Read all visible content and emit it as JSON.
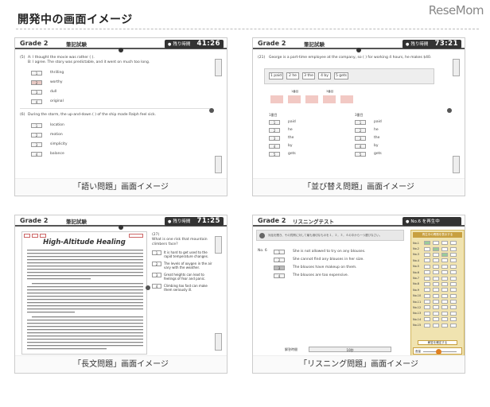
{
  "header": {
    "title": "開発中の画面イメージ",
    "brand": "ReseMom"
  },
  "panels": [
    {
      "caption": "「語い問題」画面イメージ",
      "grade": "Grade 2",
      "subject": "筆記試験",
      "timer_label": "残り時間",
      "time": "41:26",
      "q1": {
        "label": "(5)",
        "line1": "A: I thought the movie was rather (     ).",
        "line2": "B: I agree. The story was predictable, and it went on much too long.",
        "options": [
          {
            "n": "1",
            "t": "thrilling"
          },
          {
            "n": "2",
            "t": "worthy"
          },
          {
            "n": "3",
            "t": "dull"
          },
          {
            "n": "4",
            "t": "original"
          }
        ],
        "selected": "2"
      },
      "q2": {
        "label": "(6)",
        "line1": "During the storm, the up-and-down (     ) of the ship made Ralph feel sick.",
        "options": [
          {
            "n": "1",
            "t": "location"
          },
          {
            "n": "2",
            "t": "motion"
          },
          {
            "n": "3",
            "t": "simplicity"
          },
          {
            "n": "4",
            "t": "balance"
          }
        ]
      }
    },
    {
      "caption": "「並び替え問題」画面イメージ",
      "grade": "Grade 2",
      "subject": "筆記試験",
      "timer_label": "残り時間",
      "time": "73:21",
      "q": {
        "label": "(21)",
        "text": "George is a part-time employee at the company, so (     ) for working 4 hours, he makes $40."
      },
      "tiles": [
        "1 paid",
        "2 he",
        "3 the",
        "4 by",
        "5 gets"
      ],
      "slot_labels": [
        "1番目",
        "3番目"
      ],
      "col1": [
        {
          "n": "1",
          "t": "paid"
        },
        {
          "n": "2",
          "t": "he"
        },
        {
          "n": "3",
          "t": "the"
        },
        {
          "n": "4",
          "t": "by"
        },
        {
          "n": "5",
          "t": "gets"
        }
      ],
      "col2": [
        {
          "n": "1",
          "t": "paid"
        },
        {
          "n": "2",
          "t": "he"
        },
        {
          "n": "3",
          "t": "the"
        },
        {
          "n": "4",
          "t": "by"
        },
        {
          "n": "5",
          "t": "gets"
        }
      ]
    },
    {
      "caption": "「長文問題」画面イメージ",
      "grade": "Grade 2",
      "subject": "筆記試験",
      "timer_label": "残り時間",
      "time": "71:25",
      "article_title": "High-Altitude Healing",
      "q": {
        "label": "(27)",
        "text": "What is one risk that mountain climbers face?",
        "options": [
          {
            "n": "1",
            "t": "It is hard to get used to the rapid temperature changes."
          },
          {
            "n": "2",
            "t": "The levels of oxygen in the air vary with the weather."
          },
          {
            "n": "3",
            "t": "Great heights can lead to feelings of fear and panic."
          },
          {
            "n": "4",
            "t": "Climbing too fast can make them seriously ill."
          }
        ]
      }
    },
    {
      "caption": "「リスニング問題」画面イメージ",
      "grade": "Grade 2",
      "subject": "リスニングテスト",
      "timer_label": "No.6 を再生中",
      "time": "",
      "instruction": "対話を聞き、その質問に対して最も適切なものを１，２，３，４の中から一つ選びなさい。",
      "qno": "No. 6",
      "options": [
        {
          "n": "1",
          "t": "She is not allowed to try on any blouses."
        },
        {
          "n": "2",
          "t": "She cannot find any blouses in her size."
        },
        {
          "n": "3",
          "t": "The blouses have makeup on them."
        },
        {
          "n": "4",
          "t": "The blouses are too expensive."
        }
      ],
      "selected": "3",
      "progress_label": "解答時間",
      "progress_value": "10秒",
      "grid_header": "再生中の問題を表示する",
      "rows": [
        "No.1",
        "No.2",
        "No.3",
        "No.4",
        "No.5",
        "No.6",
        "No.7",
        "No.8",
        "No.9",
        "No.10",
        "No.11",
        "No.12",
        "No.13",
        "No.14",
        "No.15"
      ],
      "confirm_label": "解答を確定する",
      "volume_label": "音量"
    }
  ]
}
